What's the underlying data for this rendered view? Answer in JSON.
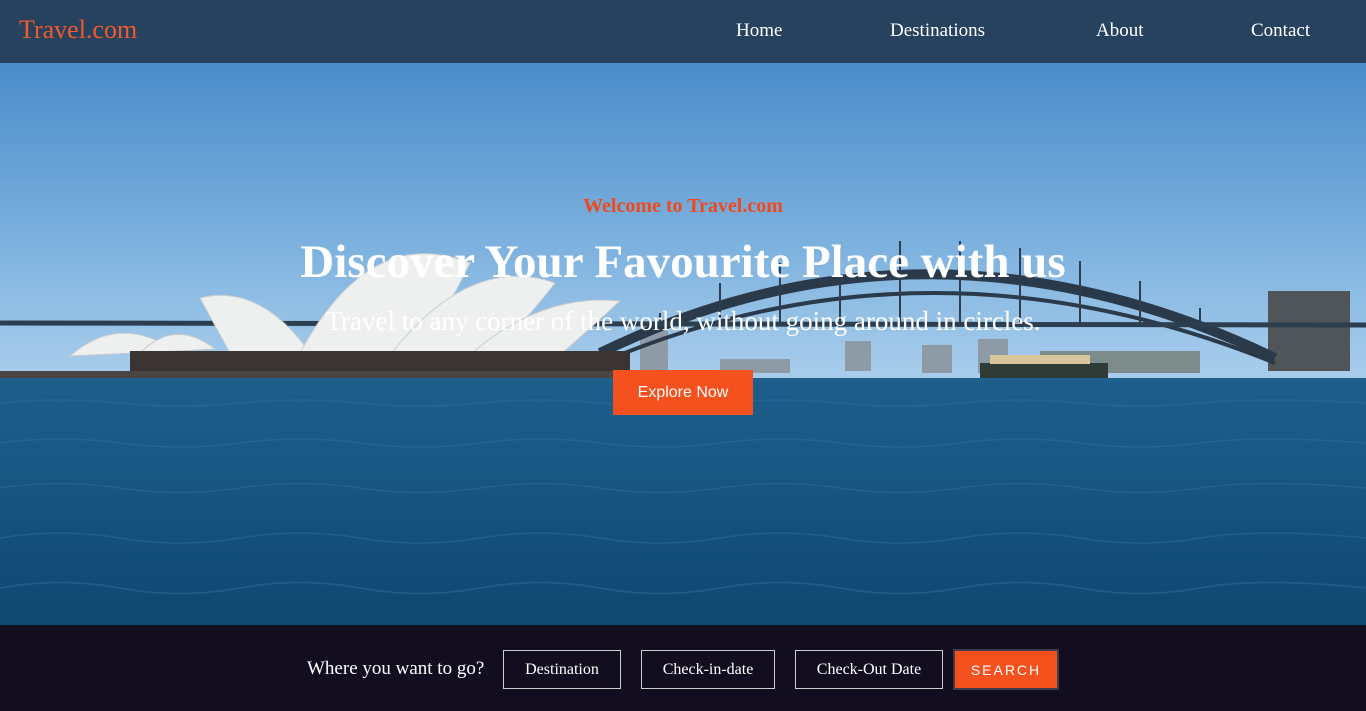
{
  "nav": {
    "brand": "Travel.com",
    "links": [
      "Home",
      "Destinations",
      "About",
      "Contact"
    ]
  },
  "hero": {
    "welcome": "Welcome to Travel.com",
    "title": "Discover Your Favourite Place with us",
    "subtitle": "Travel to any corner of the world, without going around in circles.",
    "cta_label": "Explore Now",
    "background_image": "sydney-harbour-opera-house-bridge"
  },
  "search": {
    "prompt": "Where you want to go?",
    "destination_placeholder": "Destination",
    "checkin_placeholder": "Check-in-date",
    "checkout_placeholder": "Check-Out Date",
    "button_label": "SEARCH"
  },
  "colors": {
    "nav_bg": "#26425f",
    "accent": "#f4511e",
    "search_bg": "#130d20"
  }
}
